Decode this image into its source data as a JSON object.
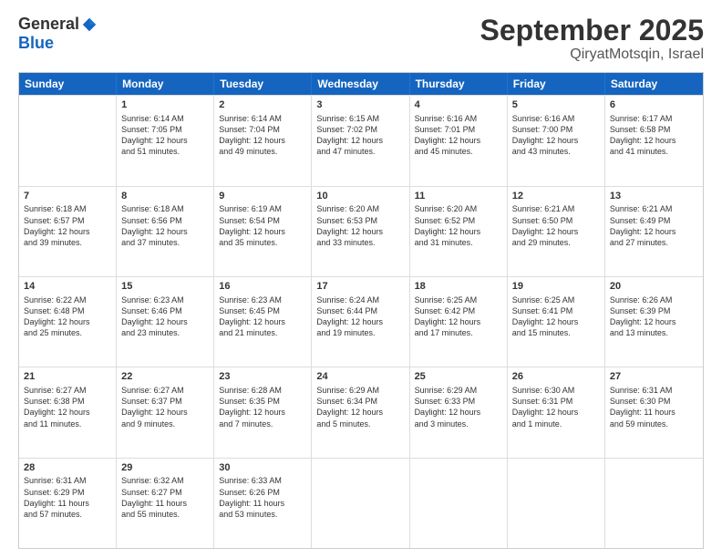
{
  "header": {
    "logo_general": "General",
    "logo_blue": "Blue",
    "main_title": "September 2025",
    "subtitle": "QiryatMotsqin, Israel"
  },
  "calendar": {
    "days_of_week": [
      "Sunday",
      "Monday",
      "Tuesday",
      "Wednesday",
      "Thursday",
      "Friday",
      "Saturday"
    ],
    "weeks": [
      [
        {
          "day": "",
          "lines": []
        },
        {
          "day": "1",
          "lines": [
            "Sunrise: 6:14 AM",
            "Sunset: 7:05 PM",
            "Daylight: 12 hours",
            "and 51 minutes."
          ]
        },
        {
          "day": "2",
          "lines": [
            "Sunrise: 6:14 AM",
            "Sunset: 7:04 PM",
            "Daylight: 12 hours",
            "and 49 minutes."
          ]
        },
        {
          "day": "3",
          "lines": [
            "Sunrise: 6:15 AM",
            "Sunset: 7:02 PM",
            "Daylight: 12 hours",
            "and 47 minutes."
          ]
        },
        {
          "day": "4",
          "lines": [
            "Sunrise: 6:16 AM",
            "Sunset: 7:01 PM",
            "Daylight: 12 hours",
            "and 45 minutes."
          ]
        },
        {
          "day": "5",
          "lines": [
            "Sunrise: 6:16 AM",
            "Sunset: 7:00 PM",
            "Daylight: 12 hours",
            "and 43 minutes."
          ]
        },
        {
          "day": "6",
          "lines": [
            "Sunrise: 6:17 AM",
            "Sunset: 6:58 PM",
            "Daylight: 12 hours",
            "and 41 minutes."
          ]
        }
      ],
      [
        {
          "day": "7",
          "lines": [
            "Sunrise: 6:18 AM",
            "Sunset: 6:57 PM",
            "Daylight: 12 hours",
            "and 39 minutes."
          ]
        },
        {
          "day": "8",
          "lines": [
            "Sunrise: 6:18 AM",
            "Sunset: 6:56 PM",
            "Daylight: 12 hours",
            "and 37 minutes."
          ]
        },
        {
          "day": "9",
          "lines": [
            "Sunrise: 6:19 AM",
            "Sunset: 6:54 PM",
            "Daylight: 12 hours",
            "and 35 minutes."
          ]
        },
        {
          "day": "10",
          "lines": [
            "Sunrise: 6:20 AM",
            "Sunset: 6:53 PM",
            "Daylight: 12 hours",
            "and 33 minutes."
          ]
        },
        {
          "day": "11",
          "lines": [
            "Sunrise: 6:20 AM",
            "Sunset: 6:52 PM",
            "Daylight: 12 hours",
            "and 31 minutes."
          ]
        },
        {
          "day": "12",
          "lines": [
            "Sunrise: 6:21 AM",
            "Sunset: 6:50 PM",
            "Daylight: 12 hours",
            "and 29 minutes."
          ]
        },
        {
          "day": "13",
          "lines": [
            "Sunrise: 6:21 AM",
            "Sunset: 6:49 PM",
            "Daylight: 12 hours",
            "and 27 minutes."
          ]
        }
      ],
      [
        {
          "day": "14",
          "lines": [
            "Sunrise: 6:22 AM",
            "Sunset: 6:48 PM",
            "Daylight: 12 hours",
            "and 25 minutes."
          ]
        },
        {
          "day": "15",
          "lines": [
            "Sunrise: 6:23 AM",
            "Sunset: 6:46 PM",
            "Daylight: 12 hours",
            "and 23 minutes."
          ]
        },
        {
          "day": "16",
          "lines": [
            "Sunrise: 6:23 AM",
            "Sunset: 6:45 PM",
            "Daylight: 12 hours",
            "and 21 minutes."
          ]
        },
        {
          "day": "17",
          "lines": [
            "Sunrise: 6:24 AM",
            "Sunset: 6:44 PM",
            "Daylight: 12 hours",
            "and 19 minutes."
          ]
        },
        {
          "day": "18",
          "lines": [
            "Sunrise: 6:25 AM",
            "Sunset: 6:42 PM",
            "Daylight: 12 hours",
            "and 17 minutes."
          ]
        },
        {
          "day": "19",
          "lines": [
            "Sunrise: 6:25 AM",
            "Sunset: 6:41 PM",
            "Daylight: 12 hours",
            "and 15 minutes."
          ]
        },
        {
          "day": "20",
          "lines": [
            "Sunrise: 6:26 AM",
            "Sunset: 6:39 PM",
            "Daylight: 12 hours",
            "and 13 minutes."
          ]
        }
      ],
      [
        {
          "day": "21",
          "lines": [
            "Sunrise: 6:27 AM",
            "Sunset: 6:38 PM",
            "Daylight: 12 hours",
            "and 11 minutes."
          ]
        },
        {
          "day": "22",
          "lines": [
            "Sunrise: 6:27 AM",
            "Sunset: 6:37 PM",
            "Daylight: 12 hours",
            "and 9 minutes."
          ]
        },
        {
          "day": "23",
          "lines": [
            "Sunrise: 6:28 AM",
            "Sunset: 6:35 PM",
            "Daylight: 12 hours",
            "and 7 minutes."
          ]
        },
        {
          "day": "24",
          "lines": [
            "Sunrise: 6:29 AM",
            "Sunset: 6:34 PM",
            "Daylight: 12 hours",
            "and 5 minutes."
          ]
        },
        {
          "day": "25",
          "lines": [
            "Sunrise: 6:29 AM",
            "Sunset: 6:33 PM",
            "Daylight: 12 hours",
            "and 3 minutes."
          ]
        },
        {
          "day": "26",
          "lines": [
            "Sunrise: 6:30 AM",
            "Sunset: 6:31 PM",
            "Daylight: 12 hours",
            "and 1 minute."
          ]
        },
        {
          "day": "27",
          "lines": [
            "Sunrise: 6:31 AM",
            "Sunset: 6:30 PM",
            "Daylight: 11 hours",
            "and 59 minutes."
          ]
        }
      ],
      [
        {
          "day": "28",
          "lines": [
            "Sunrise: 6:31 AM",
            "Sunset: 6:29 PM",
            "Daylight: 11 hours",
            "and 57 minutes."
          ]
        },
        {
          "day": "29",
          "lines": [
            "Sunrise: 6:32 AM",
            "Sunset: 6:27 PM",
            "Daylight: 11 hours",
            "and 55 minutes."
          ]
        },
        {
          "day": "30",
          "lines": [
            "Sunrise: 6:33 AM",
            "Sunset: 6:26 PM",
            "Daylight: 11 hours",
            "and 53 minutes."
          ]
        },
        {
          "day": "",
          "lines": []
        },
        {
          "day": "",
          "lines": []
        },
        {
          "day": "",
          "lines": []
        },
        {
          "day": "",
          "lines": []
        }
      ]
    ]
  }
}
